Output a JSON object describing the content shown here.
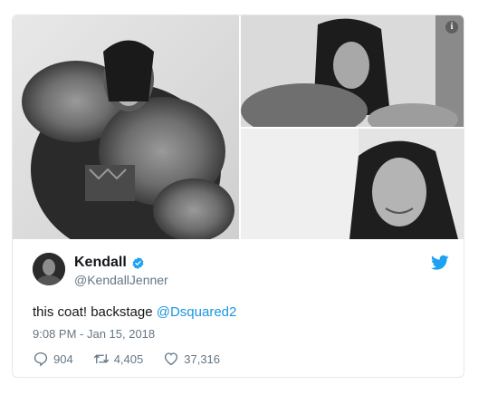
{
  "photos": [
    {
      "description_icon": "photo-coat"
    },
    {
      "description_icon": "photo-portrait"
    },
    {
      "description_icon": "photo-smile"
    }
  ],
  "info_icon_glyph": "i",
  "author": {
    "display_name": "Kendall",
    "handle": "@KendallJenner",
    "verified": true
  },
  "tweet": {
    "text": "this coat! backstage ",
    "mention": "@Dsquared2",
    "timestamp": "9:08 PM - Jan 15, 2018"
  },
  "actions": {
    "replies": "904",
    "retweets": "4,405",
    "likes": "37,316"
  },
  "colors": {
    "brand": "#1da1f2",
    "link": "#1b95e0",
    "muted": "#657786"
  }
}
